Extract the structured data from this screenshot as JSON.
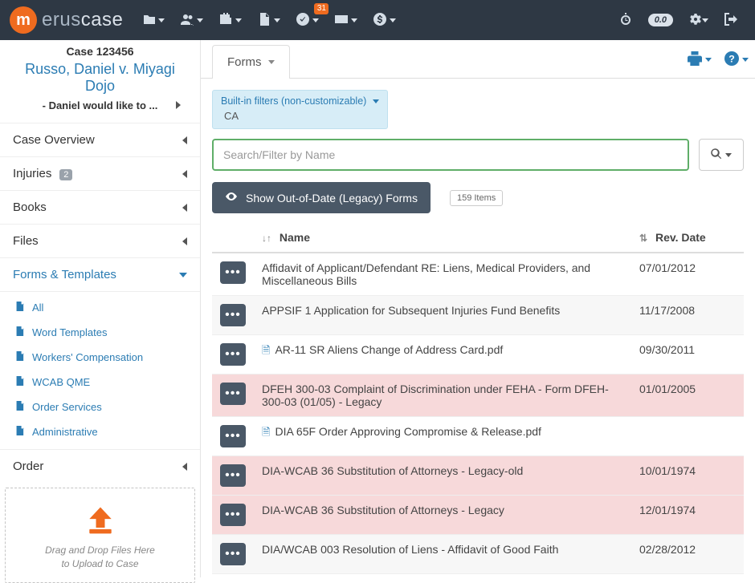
{
  "brand": {
    "m": "m",
    "erus": "erus",
    "case": "case"
  },
  "topbar": {
    "notif_badge": "31",
    "timer_pill": "0.0"
  },
  "case": {
    "number": "Case 123456",
    "title": "Russo, Daniel v. Miyagi Dojo",
    "subtitle": "- Daniel would like to ..."
  },
  "sidebar": {
    "sections": {
      "overview": "Case Overview",
      "injuries": "Injuries",
      "injuries_count": "2",
      "books": "Books",
      "files": "Files",
      "forms": "Forms & Templates",
      "order": "Order"
    },
    "forms_sub": [
      "All",
      "Word Templates",
      "Workers' Compensation",
      "WCAB QME",
      "Order Services",
      "Administrative"
    ],
    "dropzone_l1": "Drag and Drop Files Here",
    "dropzone_l2": "to Upload to Case"
  },
  "tabs": {
    "forms": "Forms"
  },
  "filter": {
    "title": "Built-in filters (non-customizable)",
    "value": "CA"
  },
  "search": {
    "placeholder": "Search/Filter by Name"
  },
  "legacy_button": "Show Out-of-Date (Legacy) Forms",
  "items_count": "159 Items",
  "columns": {
    "name": "Name",
    "rev": "Rev. Date"
  },
  "rows": [
    {
      "name": "Affidavit of Applicant/Defendant RE: Liens, Medical Providers, and Miscellaneous Bills",
      "date": "07/01/2012",
      "pdf": false,
      "legacy": false
    },
    {
      "name": "APPSIF 1 Application for Subsequent Injuries Fund Benefits",
      "date": "11/17/2008",
      "pdf": false,
      "legacy": false
    },
    {
      "name": "AR-11 SR Aliens Change of Address Card.pdf",
      "date": "09/30/2011",
      "pdf": true,
      "legacy": false
    },
    {
      "name": "DFEH 300-03 Complaint of Discrimination under FEHA - Form DFEH-300-03 (01/05) - Legacy",
      "date": "01/01/2005",
      "pdf": false,
      "legacy": true
    },
    {
      "name": "DIA 65F Order Approving Compromise & Release.pdf",
      "date": "",
      "pdf": true,
      "legacy": false
    },
    {
      "name": "DIA-WCAB 36 Substitution of Attorneys - Legacy-old",
      "date": "10/01/1974",
      "pdf": false,
      "legacy": true
    },
    {
      "name": "DIA-WCAB 36 Substitution of Attorneys - Legacy",
      "date": "12/01/1974",
      "pdf": false,
      "legacy": true
    },
    {
      "name": "DIA/WCAB 003 Resolution of Liens - Affidavit of Good Faith",
      "date": "02/28/2012",
      "pdf": false,
      "legacy": false
    }
  ]
}
